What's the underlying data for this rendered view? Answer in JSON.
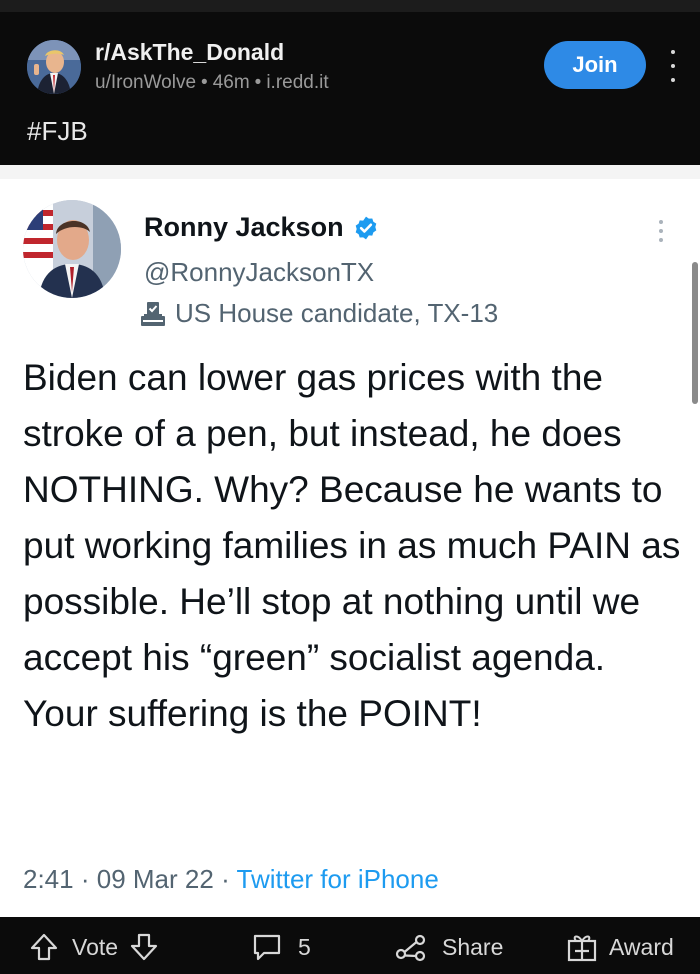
{
  "post": {
    "subreddit": "r/AskThe_Donald",
    "author": "u/IronWolve",
    "age": "46m",
    "domain": "i.redd.it",
    "dot": "•",
    "join_label": "Join",
    "title": "#FJB"
  },
  "tweet": {
    "name": "Ronny Jackson",
    "handle": "@RonnyJacksonTX",
    "label": "US House candidate, TX-13",
    "body": "Biden can lower gas prices with the stroke of a pen, but instead, he does NOTHING. Why? Because he wants to put working families in as much PAIN as possible. He’ll stop at nothing until we accept his “green” socialist agenda. Your suffering is the POINT!",
    "time": "2:41",
    "date": "09 Mar 22",
    "source": "Twitter for iPhone",
    "sep": "·"
  },
  "actions": {
    "vote_label": "Vote",
    "comments_count": "5",
    "share_label": "Share",
    "award_label": "Award"
  },
  "icons": {
    "verified": "verified-badge-icon",
    "label": "ballot-box-icon",
    "upvote": "upvote-arrow-icon",
    "downvote": "downvote-arrow-icon",
    "comment": "comment-bubble-icon",
    "share": "share-icon",
    "award": "gift-award-icon",
    "more": "more-vertical-icon"
  },
  "colors": {
    "join": "#2e8ae6",
    "verified": "#1d9bf0",
    "link": "#1d9bf0",
    "background": "#0b0b0b"
  }
}
